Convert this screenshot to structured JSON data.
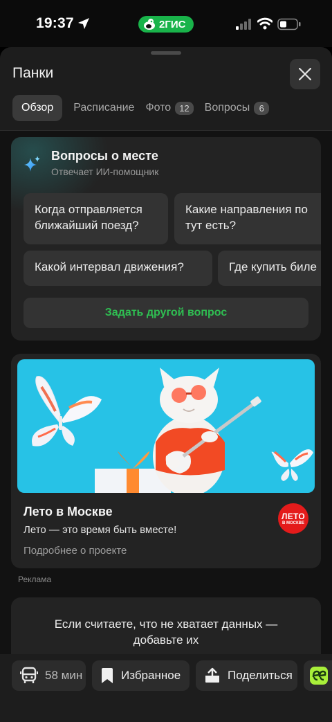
{
  "status_bar": {
    "time": "19:37",
    "app_badge": "2ГИС"
  },
  "sheet": {
    "title": "Панки",
    "tabs": [
      {
        "label": "Обзор",
        "count": ""
      },
      {
        "label": "Расписание",
        "count": ""
      },
      {
        "label": "Фото",
        "count": "12"
      },
      {
        "label": "Вопросы",
        "count": "6"
      }
    ]
  },
  "ai_card": {
    "title": "Вопросы о месте",
    "subtitle": "Отвечает ИИ-помощник",
    "questions": [
      "Когда отправляется\nближайший поезд?",
      "Какие направления по\nтут есть?",
      "Какой интервал движения?",
      "Где купить биле"
    ],
    "ask_button": "Задать другой вопрос"
  },
  "ad": {
    "title": "Лето в Москве",
    "text": "Лето — это время быть вместе!",
    "link": "Подробнее о проекте",
    "logo_line1": "ЛЕТО",
    "logo_line2": "В МОСКВЕ",
    "label": "Реклама"
  },
  "missing_data": {
    "text": "Если считаете, что не хватает данных —\nдобавьте их"
  },
  "actions": {
    "transit": "58 мин",
    "favorite": "Избранное",
    "share": "Поделиться"
  },
  "colors": {
    "accent_green": "#2fbf52",
    "badge_green": "#19b34a",
    "banner_blue": "#27c2e6",
    "ad_logo_red": "#e41b1b"
  },
  "icons": {
    "location": "location-arrow-icon",
    "close": "close-icon",
    "sparkle": "sparkle-icon",
    "bus": "bus-icon",
    "bookmark": "bookmark-icon",
    "share": "share-icon"
  }
}
